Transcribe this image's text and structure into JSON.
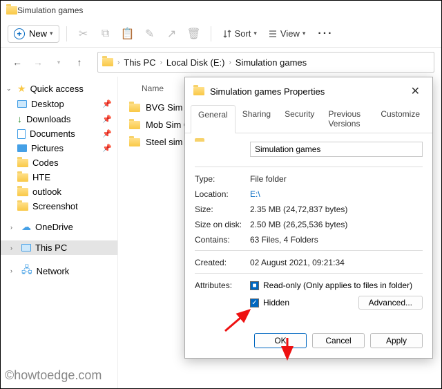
{
  "window": {
    "title": "Simulation games"
  },
  "toolbar": {
    "new_label": "New",
    "sort_label": "Sort",
    "view_label": "View"
  },
  "breadcrumb": [
    "This PC",
    "Local Disk (E:)",
    "Simulation games"
  ],
  "sidebar": {
    "quick_access": "Quick access",
    "items": [
      {
        "label": "Desktop",
        "pinned": true
      },
      {
        "label": "Downloads",
        "pinned": true
      },
      {
        "label": "Documents",
        "pinned": true
      },
      {
        "label": "Pictures",
        "pinned": true
      },
      {
        "label": "Codes",
        "pinned": false
      },
      {
        "label": "HTE",
        "pinned": false
      },
      {
        "label": "outlook",
        "pinned": false
      },
      {
        "label": "Screenshot",
        "pinned": false
      }
    ],
    "onedrive": "OneDrive",
    "thispc": "This PC",
    "network": "Network"
  },
  "content": {
    "column_header": "Name",
    "files": [
      "BVG Sim game",
      "Mob Sim Game",
      "Steel sim game"
    ]
  },
  "dialog": {
    "title": "Simulation games Properties",
    "tabs": [
      "General",
      "Sharing",
      "Security",
      "Previous Versions",
      "Customize"
    ],
    "name_value": "Simulation games",
    "rows": {
      "type_label": "Type:",
      "type_value": "File folder",
      "location_label": "Location:",
      "location_value": "E:\\",
      "size_label": "Size:",
      "size_value": "2.35 MB (24,72,837 bytes)",
      "sizeondisk_label": "Size on disk:",
      "sizeondisk_value": "2.50 MB (26,25,536 bytes)",
      "contains_label": "Contains:",
      "contains_value": "63 Files, 4 Folders",
      "created_label": "Created:",
      "created_value": "02 August 2021, 09:21:34",
      "attributes_label": "Attributes:",
      "readonly_label": "Read-only (Only applies to files in folder)",
      "hidden_label": "Hidden",
      "advanced_label": "Advanced..."
    },
    "actions": {
      "ok": "OK",
      "cancel": "Cancel",
      "apply": "Apply"
    }
  },
  "watermark": "©howtoedge.com"
}
